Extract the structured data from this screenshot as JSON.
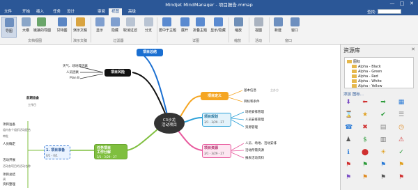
{
  "window": {
    "title": "Mindjet MindManager - 项目报告.mmap",
    "min": "—",
    "max": "□",
    "close": "✕"
  },
  "tabs": [
    "文件",
    "开始",
    "插入",
    "任务",
    "设计",
    "审阅",
    "视图",
    "高级"
  ],
  "active_tab": 6,
  "search": {
    "label": "查找:"
  },
  "ribbon": {
    "buttons": [
      "导图",
      "大纲",
      "链接的导图",
      "甘特图",
      "演示文稿",
      "显示",
      "隐藏",
      "取消过滤",
      "分支",
      "居中于主题",
      "展开",
      "折叠主题",
      "显示/隐藏",
      "缩放",
      "视图",
      "新建",
      "窗口"
    ],
    "groups": [
      "文档视图",
      "演示文稿",
      "过滤器",
      "详图",
      "缩放",
      "活动",
      "窗口"
    ]
  },
  "map": {
    "central": "C3沙龙\n活动项目",
    "topics": {
      "summary": "项目总结",
      "risk": "项目风险",
      "definition": "项目定义",
      "plan": "项目规划",
      "resources": "项目资源",
      "wbs": "任务项目\n工作分解"
    },
    "risk_subs": [
      "天气、场地等因素",
      "人员因素",
      "Plan B"
    ],
    "def_subs": [
      "基本信息",
      "目标和条件"
    ],
    "def_note": "主办方",
    "plan_subs": [
      "场地安排管理",
      "人员安排管理",
      "资源管理"
    ],
    "res_subs": [
      "人员、场地、活动安排",
      "活动所需资源",
      "报表活动资料"
    ],
    "task_badge": "工作日",
    "task_meta_1": "0/1 - 0/1",
    "task_meta_2": "3/1 - 3/29 - 27",
    "task_meta_3": "3/1 - 3/29 - 27",
    "task_meta_4": "3/1 - 3/29 - 27",
    "wbs_child": "1. 项目准备",
    "left_nodes": [
      "前期准备",
      "项目准备",
      "人员确定",
      "活动开展",
      "项目总结",
      "资料整理"
    ],
    "left_notes": [
      "组内各个组织活动配合",
      "审批",
      "活动各项目的活动名称",
      "调"
    ]
  },
  "sidebar": {
    "title": "资源库",
    "tree_root": "图标",
    "tree_items": [
      "Alpha - Black",
      "Alpha - Green",
      "Alpha - Red",
      "Alpha - White",
      "Alpha - Yellow"
    ],
    "add_label": "添加 图标..."
  },
  "colors": {
    "accent": "#2b5797",
    "summary": "#1a6fd1",
    "risk": "#111111",
    "definition": "#f5a623",
    "plan": "#2aa0d8",
    "resources": "#e85a9e",
    "wbs": "#7fbf3f"
  }
}
